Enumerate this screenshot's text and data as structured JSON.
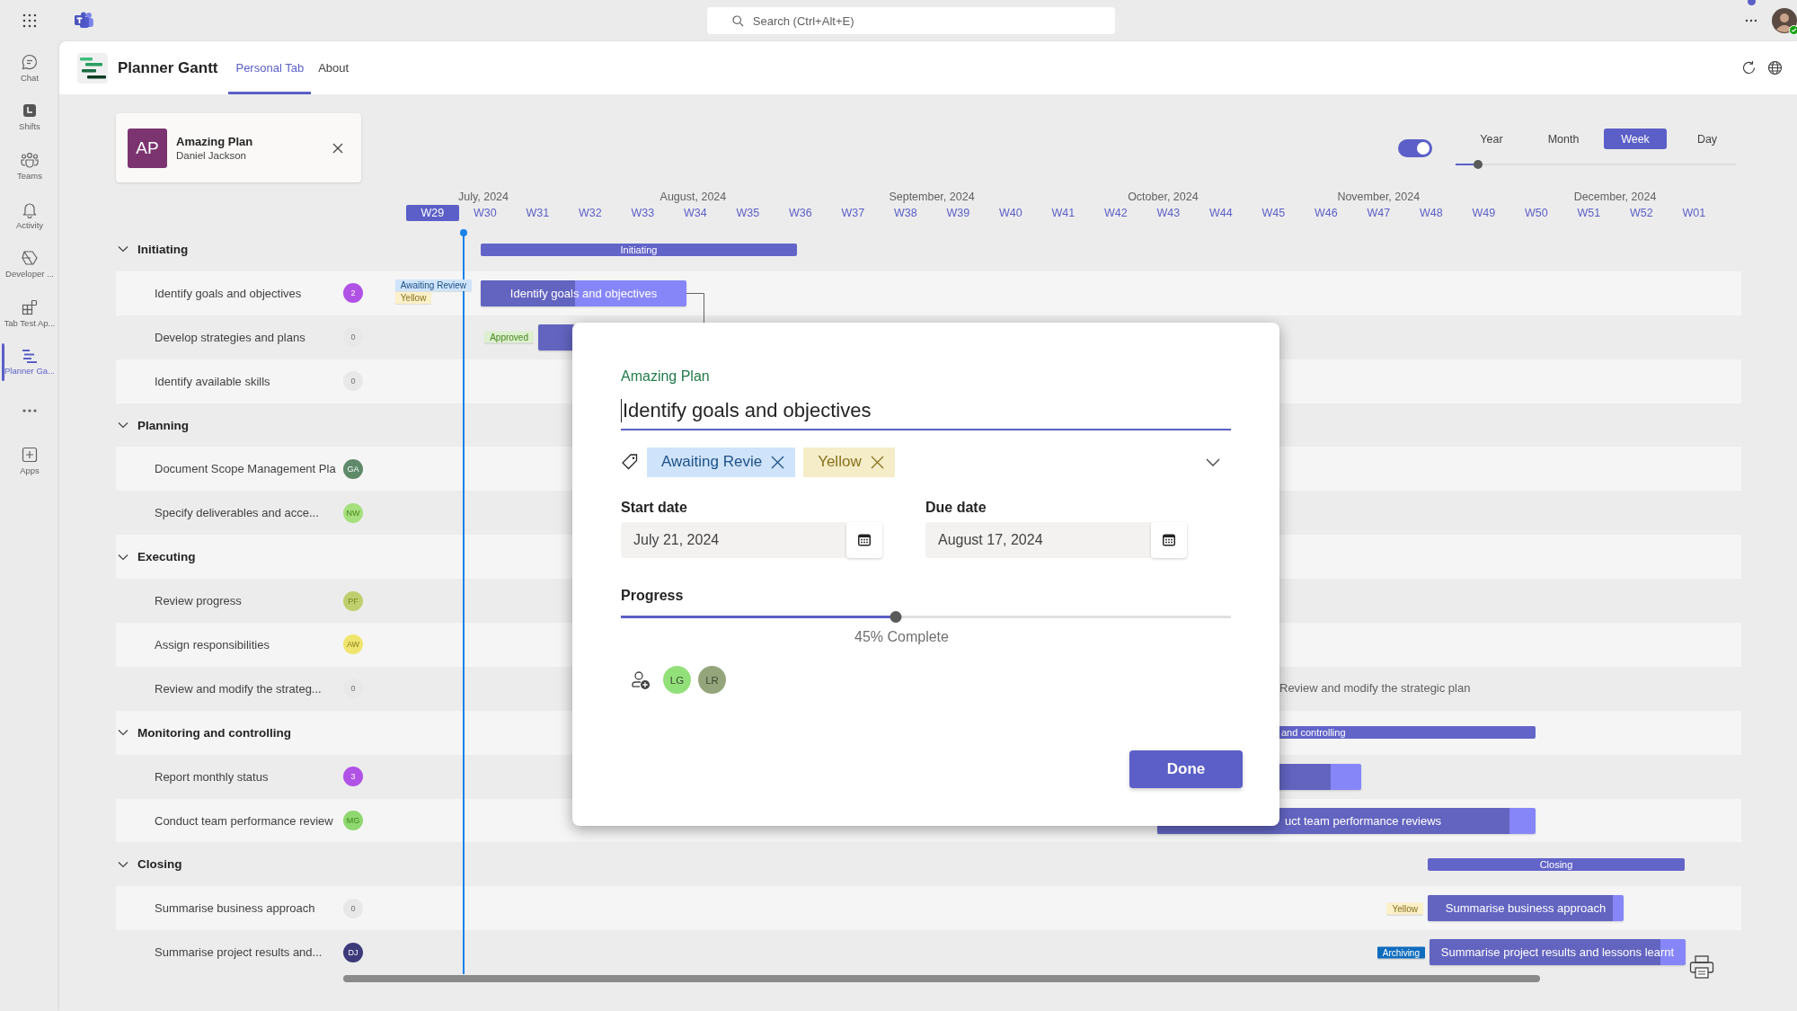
{
  "top_bar": {
    "search": {
      "placeholder": "Search (Ctrl+Alt+E)"
    },
    "user": {
      "notification": true,
      "online": true
    }
  },
  "rail": [
    {
      "kind": "chat",
      "label": "Chat",
      "selected": false
    },
    {
      "kind": "shifts",
      "label": "Shifts",
      "selected": false
    },
    {
      "kind": "teams",
      "label": "Teams",
      "selected": false
    },
    {
      "kind": "activity",
      "label": "Activity",
      "selected": false
    },
    {
      "kind": "developer",
      "label": "Developer ...",
      "selected": false
    },
    {
      "kind": "tabtest",
      "label": "Tab Test Ap...",
      "selected": false
    },
    {
      "kind": "planner",
      "label": "Planner Ga...",
      "selected": true
    },
    {
      "kind": "more",
      "selected": false
    },
    {
      "kind": "apps",
      "label": "Apps",
      "selected": false
    }
  ],
  "app": {
    "title": "Planner Gantt",
    "tabs": [
      {
        "label": "Personal Tab",
        "selected": true
      },
      {
        "label": "About",
        "selected": false
      }
    ]
  },
  "plan_card": {
    "initials": "AP",
    "name": "Amazing Plan",
    "owner": "Daniel Jackson"
  },
  "view": {
    "toggle_on": true,
    "modes": [
      {
        "label": "Year",
        "selected": false
      },
      {
        "label": "Month",
        "selected": false
      },
      {
        "label": "Week",
        "selected": true
      },
      {
        "label": "Day",
        "selected": false
      }
    ],
    "zoom": {
      "level": 0.08
    }
  },
  "timescale": {
    "months": [
      "July, 2024",
      "August, 2024",
      "September, 2024",
      "October, 2024",
      "November, 2024",
      "December, 2024"
    ],
    "weeks": [
      {
        "label": "W29",
        "selected": true
      },
      {
        "label": "W30",
        "selected": false
      },
      {
        "label": "W31",
        "selected": false
      },
      {
        "label": "W32",
        "selected": false
      },
      {
        "label": "W33",
        "selected": false
      },
      {
        "label": "W34",
        "selected": false
      },
      {
        "label": "W35",
        "selected": false
      },
      {
        "label": "W36",
        "selected": false
      },
      {
        "label": "W37",
        "selected": false
      },
      {
        "label": "W38",
        "selected": false
      },
      {
        "label": "W39",
        "selected": false
      },
      {
        "label": "W40",
        "selected": false
      },
      {
        "label": "W41",
        "selected": false
      },
      {
        "label": "W42",
        "selected": false
      },
      {
        "label": "W43",
        "selected": false
      },
      {
        "label": "W44",
        "selected": false
      },
      {
        "label": "W45",
        "selected": false
      },
      {
        "label": "W46",
        "selected": false
      },
      {
        "label": "W47",
        "selected": false
      },
      {
        "label": "W48",
        "selected": false
      },
      {
        "label": "W49",
        "selected": false
      },
      {
        "label": "W50",
        "selected": false
      },
      {
        "label": "W51",
        "selected": false
      },
      {
        "label": "W52",
        "selected": false
      },
      {
        "label": "W01",
        "selected": false
      }
    ]
  },
  "groups": [
    {
      "name": "Initiating",
      "expanded": true,
      "bar": {
        "kind": "summary",
        "label": "Initiating"
      },
      "tasks": [
        {
          "name": "Identify goals and objectives",
          "badge": {
            "text": "2",
            "color": "#b052e6"
          },
          "bar": {
            "kind": "task",
            "label": "Identify goals and objectives",
            "level": 0.46
          },
          "tags": [
            {
              "label": "Awaiting Review",
              "color": "#cfe4fa"
            },
            {
              "label": "Yellow",
              "color": "#fbf0c8"
            }
          ]
        },
        {
          "name": "Develop strategies and plans",
          "badge": {
            "text": "0",
            "color": "#e8e8e8"
          },
          "bar": {
            "kind": "task"
          },
          "tags": [
            {
              "label": "Approved",
              "color": "#dcefcf"
            }
          ]
        },
        {
          "name": "Identify available skills",
          "badge": {
            "text": "0",
            "color": "#e8e8e8"
          }
        }
      ]
    },
    {
      "name": "Planning",
      "expanded": true,
      "tasks": [
        {
          "name": "Document Scope Management Pla",
          "badge": {
            "text": "GA",
            "color": "#5f8a6a"
          }
        },
        {
          "name": "Specify deliverables and acce...",
          "badge": {
            "text": "NW",
            "color": "#a6e07e"
          }
        }
      ]
    },
    {
      "name": "Executing",
      "expanded": true,
      "tasks": [
        {
          "name": "Review progress",
          "badge": {
            "text": "PF",
            "color": "#c0cf6e"
          }
        },
        {
          "name": "Assign responsibilities",
          "badge": {
            "text": "AW",
            "color": "#efe56e"
          }
        },
        {
          "name": "Review and modify the strateg...",
          "badge": {
            "text": "0",
            "color": "#e8e8e8"
          },
          "bar": {
            "kind": "text",
            "label": "Review and modify the strategic plan"
          }
        }
      ]
    },
    {
      "name": "Monitoring and controlling",
      "expanded": true,
      "bar": {
        "kind": "summary",
        "label": "and controlling"
      },
      "tasks": [
        {
          "name": "Report monthly status",
          "badge": {
            "text": "3",
            "color": "#b052e6"
          },
          "bar": {
            "kind": "task",
            "level": 0.84
          }
        },
        {
          "name": "Conduct team performance review",
          "badge": {
            "text": "MG",
            "color": "#8fd870"
          },
          "bar": {
            "kind": "task",
            "label": "uct team performance reviews",
            "level": 0.93
          }
        }
      ]
    },
    {
      "name": "Closing",
      "expanded": true,
      "bar": {
        "kind": "summary",
        "label": "Closing"
      },
      "tasks": [
        {
          "name": "Summarise business approach",
          "badge": {
            "text": "0",
            "color": "#e8e8e8"
          },
          "bar": {
            "kind": "task",
            "label": "Summarise business approach",
            "level": 0.945
          },
          "tags": [
            {
              "label": "Yellow",
              "color": "#fbf0c8"
            }
          ]
        },
        {
          "name": "Summarise project results and...",
          "badge": {
            "text": "DJ",
            "color": "#3d3a7a"
          },
          "bar": {
            "kind": "task",
            "label": "Summarise project results and lessons learnt",
            "level": 0.9
          },
          "tags": [
            {
              "label": "Archiving",
              "color": "#0f6cbd"
            }
          ]
        }
      ]
    }
  ],
  "dialog": {
    "plan": "Amazing Plan",
    "title": "Identify goals and objectives",
    "labels": [
      {
        "label": "Awaiting Revie",
        "color": "#cfe4fa"
      },
      {
        "label": "Yellow",
        "color": "#f5ecc8"
      }
    ],
    "start": {
      "label": "Start date",
      "value": "July 21, 2024"
    },
    "due": {
      "label": "Due date",
      "value": "August 17, 2024"
    },
    "progress": {
      "label": "Progress",
      "level": 0.45,
      "reading": "45% Complete"
    },
    "assignees": [
      {
        "initials": "LG",
        "color": "#92e07a"
      },
      {
        "initials": "LR",
        "color": "#94a57c"
      }
    ],
    "done": "Done"
  }
}
